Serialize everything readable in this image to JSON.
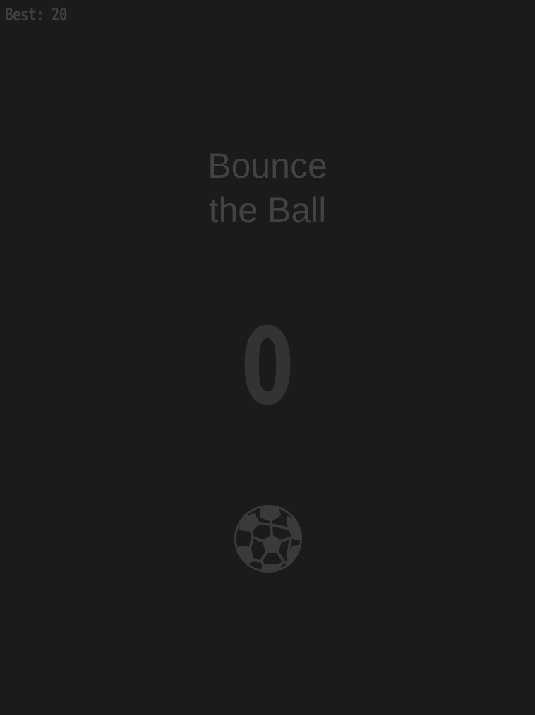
{
  "hud": {
    "best_label": "Best: 20"
  },
  "title": {
    "line1": "Bounce",
    "line2": "the Ball"
  },
  "score": {
    "value": "0"
  },
  "ball": {
    "icon": "soccer-ball-icon"
  },
  "colors": {
    "background": "#1b1b1b",
    "text": "#424242",
    "score": "#333333",
    "ball": "#3a3a3a"
  }
}
